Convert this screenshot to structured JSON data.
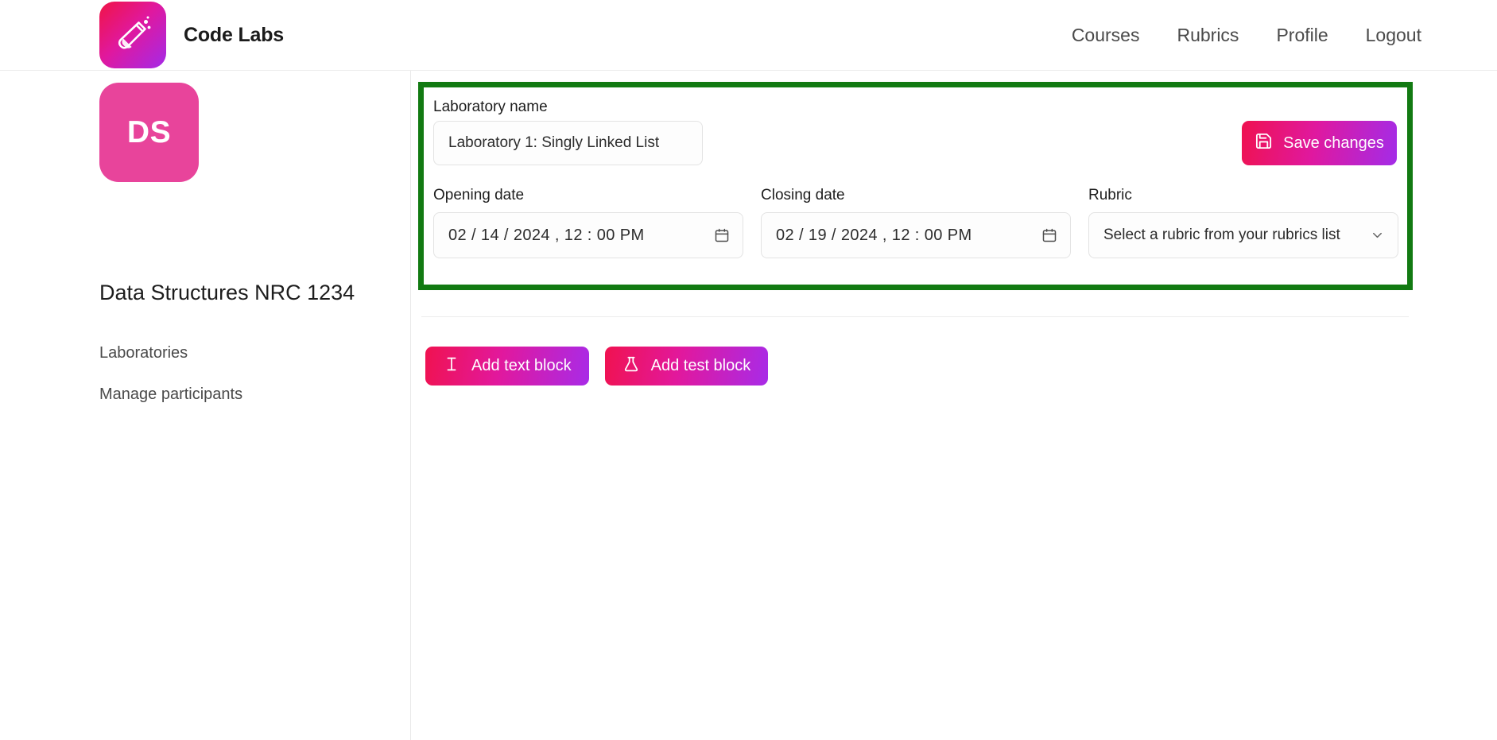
{
  "header": {
    "brand_name": "Code Labs",
    "logo_icon": "test-tube-icon",
    "nav": [
      {
        "label": "Courses"
      },
      {
        "label": "Rubrics"
      },
      {
        "label": "Profile"
      },
      {
        "label": "Logout"
      }
    ]
  },
  "sidebar": {
    "avatar_initials": "DS",
    "avatar_color": "#e8449b",
    "course_title": "Data Structures NRC 1234",
    "items": [
      {
        "label": "Laboratories"
      },
      {
        "label": "Manage participants"
      }
    ]
  },
  "main": {
    "highlight_color": "#127a12",
    "lab_name": {
      "label": "Laboratory name",
      "value": "Laboratory 1: Singly Linked List"
    },
    "save": {
      "label": "Save changes",
      "icon": "save-floppy-icon"
    },
    "opening_date": {
      "label": "Opening date",
      "value": "02 / 14 / 2024 ,  12 : 00   PM",
      "icon": "calendar-icon"
    },
    "closing_date": {
      "label": "Closing date",
      "value": "02 / 19 / 2024 ,  12 : 00   PM",
      "icon": "calendar-icon"
    },
    "rubric": {
      "label": "Rubric",
      "selected": "Select a rubric from your rubrics list",
      "icon": "chevron-down-icon"
    },
    "actions": [
      {
        "label": "Add text block",
        "icon": "text-cursor-icon"
      },
      {
        "label": "Add test block",
        "icon": "flask-icon"
      }
    ]
  }
}
